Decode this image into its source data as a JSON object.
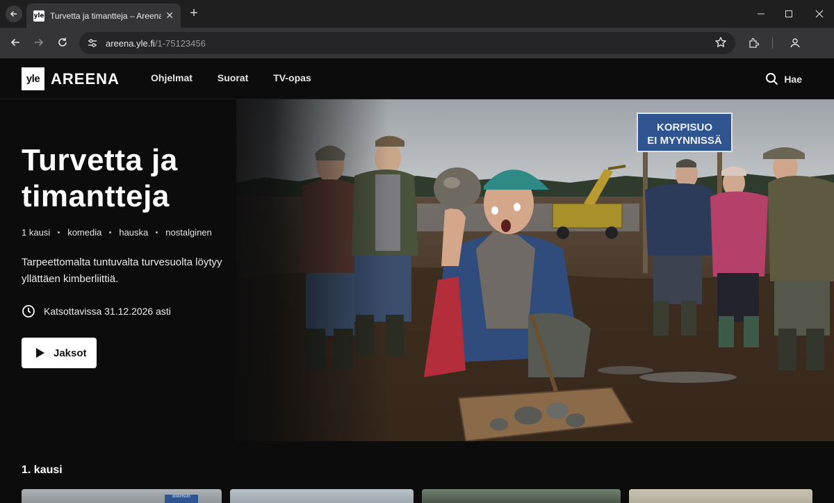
{
  "browser": {
    "tab_title": "Turvetta ja timantteja – Areena",
    "favicon_text": "yle",
    "url_host": "areena.yle.fi",
    "url_path": "/1-75123456"
  },
  "header": {
    "logo_mark": "yle",
    "logo_text": "AREENA",
    "nav": [
      "Ohjelmat",
      "Suorat",
      "TV-opas"
    ],
    "search_label": "Hae"
  },
  "hero": {
    "title_line1": "Turvetta ja",
    "title_line2": "timantteja",
    "meta": [
      "1 kausi",
      "komedia",
      "hauska",
      "nostalginen"
    ],
    "description": "Tarpeettomalta tuntuvalta turvesuolta löytyy yllättäen kimberliittiä.",
    "availability": "Katsottavissa 31.12.2026 asti",
    "play_label": "Jaksot",
    "sign_line1": "KORPISUO",
    "sign_line2": "EI MYYNNISSÄ"
  },
  "season": {
    "title": "1. kausi",
    "thumb_sign_text": "KORPISUO"
  },
  "colors": {
    "background": "#0c0c0d",
    "chrome_dark": "#1f1f20",
    "chrome": "#353537",
    "sign_blue": "#2f5591"
  },
  "icons": [
    "back-arrow-icon",
    "forward-arrow-icon",
    "reload-icon",
    "site-info-icon",
    "star-icon",
    "extensions-icon",
    "profile-icon",
    "search-icon",
    "clock-icon",
    "play-icon",
    "close-icon",
    "minimize-icon",
    "maximize-icon"
  ]
}
